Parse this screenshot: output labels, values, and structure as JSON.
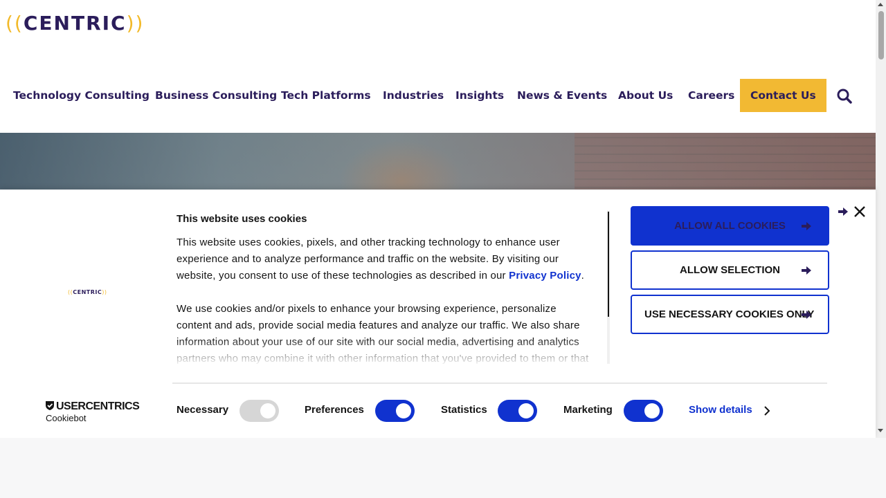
{
  "header": {
    "logo_paren_left": "((",
    "logo_word": "CENTRIC",
    "logo_paren_right": "))",
    "nav": [
      {
        "label": "Technology Consulting"
      },
      {
        "label": "Business Consulting"
      },
      {
        "label": "Tech Platforms"
      },
      {
        "label": "Industries"
      },
      {
        "label": "Insights"
      },
      {
        "label": "News & Events"
      },
      {
        "label": "About Us"
      },
      {
        "label": "Careers"
      },
      {
        "label": "Contact Us"
      }
    ],
    "search_icon": "search-icon"
  },
  "cookie_banner": {
    "logo_paren_left": "((",
    "logo_word": "CENTRIC",
    "logo_paren_right": "))",
    "title": "This website uses cookies",
    "paragraph1_before_link": "This website uses cookies, pixels, and other tracking technology to enhance user experience and to analyze performance and traffic on the website. By visiting our website, you consent to use of these technologies as described in our ",
    "privacy_link": "Privacy Policy",
    "paragraph1_after_link": ".",
    "paragraph2": "We use cookies and/or pixels to enhance your browsing experience, personalize content and ads, provide social media features and analyze our traffic. We also share information about your use of our site with our social media, advertising and analytics partners who may combine it with other information that you've provided to them or that they've collected from your use of their services.",
    "buttons": {
      "allow_all": "ALLOW ALL COOKIES",
      "allow_selection": "ALLOW SELECTION",
      "necessary_only": "USE NECESSARY COOKIES ONLY"
    },
    "toggles": [
      {
        "label": "Necessary",
        "checked": true,
        "disabled": true
      },
      {
        "label": "Preferences",
        "checked": true,
        "disabled": false
      },
      {
        "label": "Statistics",
        "checked": true,
        "disabled": false
      },
      {
        "label": "Marketing",
        "checked": true,
        "disabled": false
      }
    ],
    "show_details": "Show details",
    "powered_by_brand": "USERCENTRICS",
    "powered_by_sub": "Cookiebot"
  },
  "colors": {
    "brand_navy": "#2b1d5b",
    "brand_yellow": "#f2b933",
    "accent_blue": "#1032cf"
  }
}
